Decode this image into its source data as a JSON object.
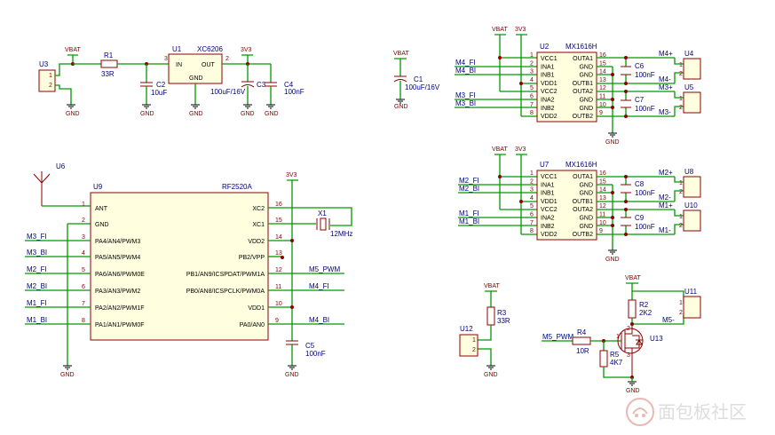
{
  "power": {
    "vbat": "VBAT",
    "v33": "3V3",
    "gnd": "GND"
  },
  "top_left": {
    "u3": "U3",
    "u3_p1": "1",
    "u3_p2": "2",
    "r1": "R1",
    "r1_val": "33R",
    "u1": "U1",
    "u1_part": "XC6206",
    "u1_in": "IN",
    "u1_out": "OUT",
    "u1_gnd": "GND",
    "u1_p3": "3",
    "u1_p2": "2",
    "c2": "C2",
    "c2_val": "10uF",
    "c3": "C3",
    "c3_val": "100uF/16V",
    "c4": "C4",
    "c4_val": "100nF"
  },
  "mid_top": {
    "c1": "C1",
    "c1_val": "100uF/16V"
  },
  "driver1": {
    "ref": "U2",
    "part": "MX1616H",
    "left_pins": [
      {
        "num": "1",
        "name": "VCC1"
      },
      {
        "num": "2",
        "name": "INA1"
      },
      {
        "num": "3",
        "name": "INB1"
      },
      {
        "num": "4",
        "name": "VDD1"
      },
      {
        "num": "5",
        "name": "VCC2"
      },
      {
        "num": "6",
        "name": "INA2"
      },
      {
        "num": "7",
        "name": "INB2"
      },
      {
        "num": "8",
        "name": "VDD2"
      }
    ],
    "right_pins": [
      {
        "num": "16",
        "name": "OUTA1"
      },
      {
        "num": "15",
        "name": "GND"
      },
      {
        "num": "14",
        "name": "GND"
      },
      {
        "num": "13",
        "name": "OUTB1"
      },
      {
        "num": "12",
        "name": "OUTA2"
      },
      {
        "num": "11",
        "name": "GND"
      },
      {
        "num": "10",
        "name": "GND"
      },
      {
        "num": "9",
        "name": "OUTB2"
      }
    ],
    "nets_in": [
      "M4_FI",
      "M4_BI",
      "M3_FI",
      "M3_BI"
    ],
    "cap_a": "C6",
    "cap_a_val": "100nF",
    "cap_b": "C7",
    "cap_b_val": "100nF",
    "out_nets": [
      "M4+",
      "M4-",
      "M3+",
      "M3-"
    ],
    "conn_a": "U4",
    "conn_b": "U5"
  },
  "driver2": {
    "ref": "U7",
    "part": "MX1616H",
    "left_pins": [
      {
        "num": "1",
        "name": "VCC1"
      },
      {
        "num": "2",
        "name": "INA1"
      },
      {
        "num": "3",
        "name": "INB1"
      },
      {
        "num": "4",
        "name": "VDD1"
      },
      {
        "num": "5",
        "name": "VCC2"
      },
      {
        "num": "6",
        "name": "INA2"
      },
      {
        "num": "7",
        "name": "INB2"
      },
      {
        "num": "8",
        "name": "VDD2"
      }
    ],
    "right_pins": [
      {
        "num": "16",
        "name": "OUTA1"
      },
      {
        "num": "15",
        "name": "GND"
      },
      {
        "num": "14",
        "name": "GND"
      },
      {
        "num": "13",
        "name": "OUTB1"
      },
      {
        "num": "12",
        "name": "OUTA2"
      },
      {
        "num": "11",
        "name": "GND"
      },
      {
        "num": "10",
        "name": "GND"
      },
      {
        "num": "9",
        "name": "OUTB2"
      }
    ],
    "nets_in": [
      "M2_FI",
      "M2_BI",
      "M1_FI",
      "M1_BI"
    ],
    "cap_a": "C8",
    "cap_a_val": "100nF",
    "cap_b": "C9",
    "cap_b_val": "100nF",
    "out_nets": [
      "M2+",
      "M2-",
      "M1+",
      "M1-"
    ],
    "conn_a": "U8",
    "conn_b": "U10"
  },
  "mcu": {
    "ant_ref": "U6",
    "ref": "U9",
    "part": "RF2520A",
    "left_pins": [
      {
        "num": "1",
        "name": "ANT",
        "net": ""
      },
      {
        "num": "2",
        "name": "GND",
        "net": ""
      },
      {
        "num": "3",
        "name": "PA4/AN4/PWM3",
        "net": "M3_FI"
      },
      {
        "num": "4",
        "name": "PA5/AN5/PWM4",
        "net": "M3_BI"
      },
      {
        "num": "5",
        "name": "PA6/AN6/PWM0E",
        "net": "M2_FI"
      },
      {
        "num": "6",
        "name": "PA3/AN3/PWM2",
        "net": "M2_BI"
      },
      {
        "num": "7",
        "name": "PA2/AN2/PWM1F",
        "net": "M1_FI"
      },
      {
        "num": "8",
        "name": "PA1/AN1/PWM0F",
        "net": "M1_BI"
      }
    ],
    "right_pins": [
      {
        "num": "16",
        "name": "XC2",
        "net": ""
      },
      {
        "num": "15",
        "name": "XC1",
        "net": ""
      },
      {
        "num": "14",
        "name": "VDD2",
        "net": ""
      },
      {
        "num": "13",
        "name": "PB2/VPP",
        "net": ""
      },
      {
        "num": "12",
        "name": "PB1/AN9/ICSPDAT/PWM1A",
        "net": "M5_PWM"
      },
      {
        "num": "11",
        "name": "PB0/AN8/ICSPCLK/PWM0A",
        "net": "M4_FI"
      },
      {
        "num": "10",
        "name": "VDD1",
        "net": ""
      },
      {
        "num": "9",
        "name": "PA0/AN0",
        "net": "M4_BI"
      }
    ],
    "xtal": "X1",
    "xtal_val": "12MHz",
    "c5": "C5",
    "c5_val": "100nF"
  },
  "bottom_mid": {
    "u12": "U12",
    "p1": "1",
    "p2": "2",
    "r3": "R3",
    "r3_val": "33R"
  },
  "bottom_right": {
    "r2": "R2",
    "r2_val": "2K2",
    "u11": "U11",
    "p1": "1",
    "p2": "2",
    "net_m5": "M5-",
    "pwm_net": "M5_PWM",
    "r4": "R4",
    "r4_val": "10R",
    "r5": "R5",
    "r5_val": "4K7",
    "q": "U13",
    "q_pins": [
      "1",
      "2",
      "3"
    ]
  },
  "watermark": "面包板社区",
  "colors": {
    "wire": "#009900",
    "body": "#8b0000",
    "fill": "#ffffe0",
    "net": "#000080"
  }
}
